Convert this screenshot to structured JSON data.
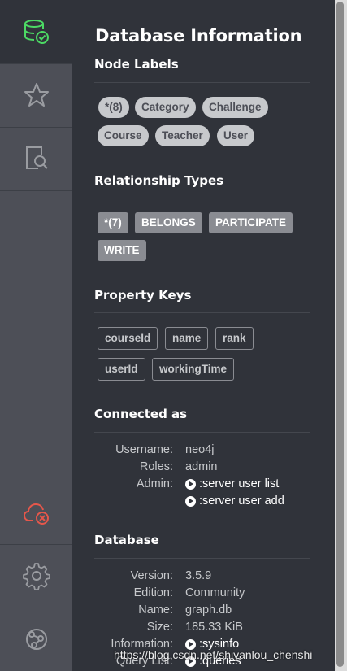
{
  "sidebar": {
    "items": [
      {
        "name": "database-icon",
        "active": true,
        "color": "#4cd964"
      },
      {
        "name": "star-icon",
        "active": false
      },
      {
        "name": "search-document-icon",
        "active": false
      },
      {
        "name": "disconnected-cloud-icon",
        "active": false,
        "color": "#e5574b"
      },
      {
        "name": "gear-icon",
        "active": false
      },
      {
        "name": "neo4j-browser-sync-icon",
        "active": false
      }
    ]
  },
  "drawer": {
    "title": "Database Information",
    "node_labels": {
      "heading": "Node Labels",
      "items": [
        "*(8)",
        "Category",
        "Challenge",
        "Course",
        "Teacher",
        "User"
      ]
    },
    "relationship_types": {
      "heading": "Relationship Types",
      "items": [
        "*(7)",
        "BELONGS",
        "PARTICIPATE",
        "WRITE"
      ]
    },
    "property_keys": {
      "heading": "Property Keys",
      "items": [
        "courseId",
        "name",
        "rank",
        "userId",
        "workingTime"
      ]
    },
    "connected_as": {
      "heading": "Connected as",
      "username_label": "Username:",
      "username": "neo4j",
      "roles_label": "Roles:",
      "roles": "admin",
      "admin_label": "Admin:",
      "admin_cmd1": ":server user list",
      "admin_cmd2": ":server user add"
    },
    "database": {
      "heading": "Database",
      "version_label": "Version:",
      "version": "3.5.9",
      "edition_label": "Edition:",
      "edition": "Community",
      "name_label": "Name:",
      "name": "graph.db",
      "size_label": "Size:",
      "size": "185.33 KiB",
      "information_label": "Information:",
      "information_cmd": ":sysinfo",
      "query_list_label": "Query List:",
      "query_list_cmd": ":queries"
    }
  },
  "watermark": "https://blog.csdn.net/shiyanlou_chenshi",
  "colors": {
    "background": "#30333a",
    "sidebar": "#4d4f57",
    "accent_green": "#4cd964",
    "accent_red": "#e5574b"
  }
}
